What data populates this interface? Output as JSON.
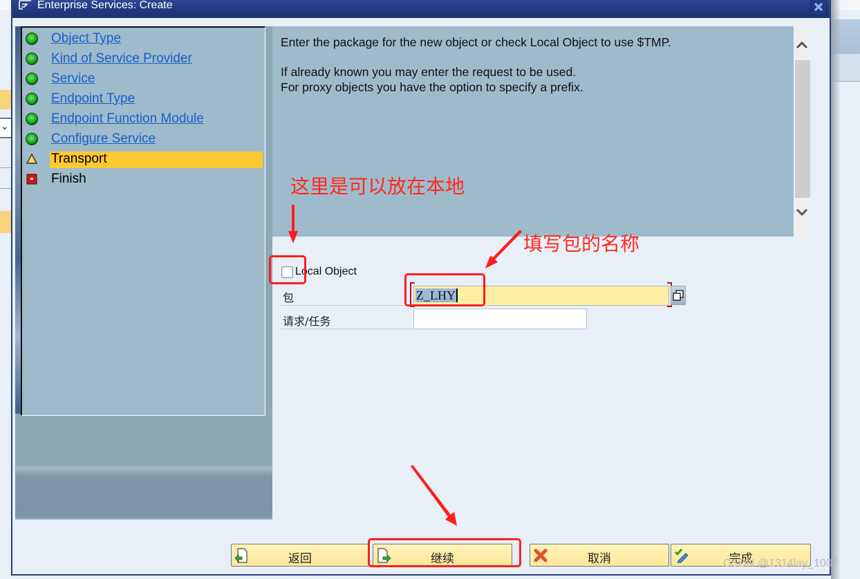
{
  "window": {
    "title": "Enterprise Services: Create",
    "close_icon": "close-icon"
  },
  "nav": {
    "items": [
      {
        "label": "Object Type",
        "status": "complete",
        "icon": "green-led-icon"
      },
      {
        "label": "Kind of Service Provider",
        "status": "complete",
        "icon": "green-led-icon"
      },
      {
        "label": "Service",
        "status": "complete",
        "icon": "green-led-icon"
      },
      {
        "label": "Endpoint Type",
        "status": "complete",
        "icon": "green-led-icon"
      },
      {
        "label": "Endpoint Function Module",
        "status": "complete",
        "icon": "green-led-icon"
      },
      {
        "label": "Configure Service",
        "status": "complete",
        "icon": "green-led-icon"
      },
      {
        "label": "Transport",
        "status": "current",
        "icon": "warning-triangle-icon"
      },
      {
        "label": "Finish",
        "status": "pending",
        "icon": "red-square-icon"
      }
    ]
  },
  "info": {
    "line1": "Enter the package for the new object or check Local Object to use $TMP.",
    "line2": "If already known you may enter the request to be used.",
    "line3": "For proxy objects you have the option to specify a prefix."
  },
  "form": {
    "local_object_label": "Local Object",
    "local_object_checked": false,
    "package_label": "包",
    "package_value": "Z_LHY",
    "request_label": "请求/任务",
    "request_value": ""
  },
  "buttons": {
    "back": "返回",
    "continue": "继续",
    "cancel": "取消",
    "complete": "完成"
  },
  "annotations": {
    "local_note": "这里是可以放在本地",
    "package_note": "填写包的名称"
  },
  "watermark": "CSDN @1314lay_1007",
  "colors": {
    "titlebar": "#20397e",
    "link": "#1a5fc8",
    "active_step": "#fec931",
    "panel": "#9ebbcc",
    "annotation": "#ff2a1e",
    "required_input": "#fcefa1"
  }
}
